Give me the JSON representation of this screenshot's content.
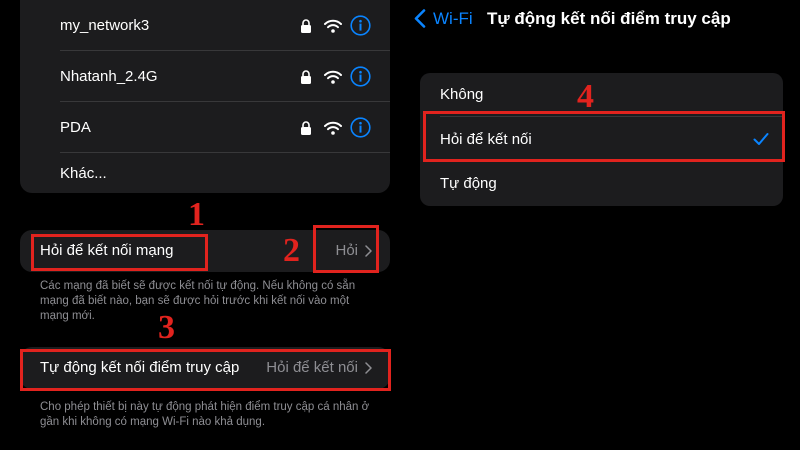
{
  "networks": [
    {
      "name": "my_network3"
    },
    {
      "name": "Nhatanh_2.4G"
    },
    {
      "name": "PDA"
    }
  ],
  "other_label": "Khác...",
  "ask_to_join": {
    "label": "Hỏi để kết nối mạng",
    "value": "Hỏi",
    "footnote": "Các mạng đã biết sẽ được kết nối tự động. Nếu không có sẵn mạng đã biết nào, bạn sẽ được hỏi trước khi kết nối vào một mạng mới."
  },
  "auto_hotspot": {
    "label": "Tự động kết nối điểm truy cập",
    "value": "Hỏi để kết nối",
    "footnote": "Cho phép thiết bị này tự động phát hiện điểm truy cập cá nhân ở gần khi không có mạng Wi-Fi nào khả dụng."
  },
  "annotations": [
    "1",
    "2",
    "3",
    "4"
  ],
  "detail": {
    "back_label": "Wi-Fi",
    "title": "Tự động kết nối điểm truy cập",
    "options": [
      {
        "label": "Không",
        "selected": false
      },
      {
        "label": "Hỏi để kết nối",
        "selected": true
      },
      {
        "label": "Tự động",
        "selected": false
      }
    ]
  },
  "colors": {
    "accent": "#0a84ff",
    "annotation_red": "#e1231e",
    "cell_background": "#1c1c1e",
    "secondary_text": "#8e8e93"
  },
  "icons": [
    "lock-icon",
    "wifi-icon",
    "info-icon",
    "chevron-right-icon",
    "back-chevron-icon",
    "checkmark-icon"
  ]
}
